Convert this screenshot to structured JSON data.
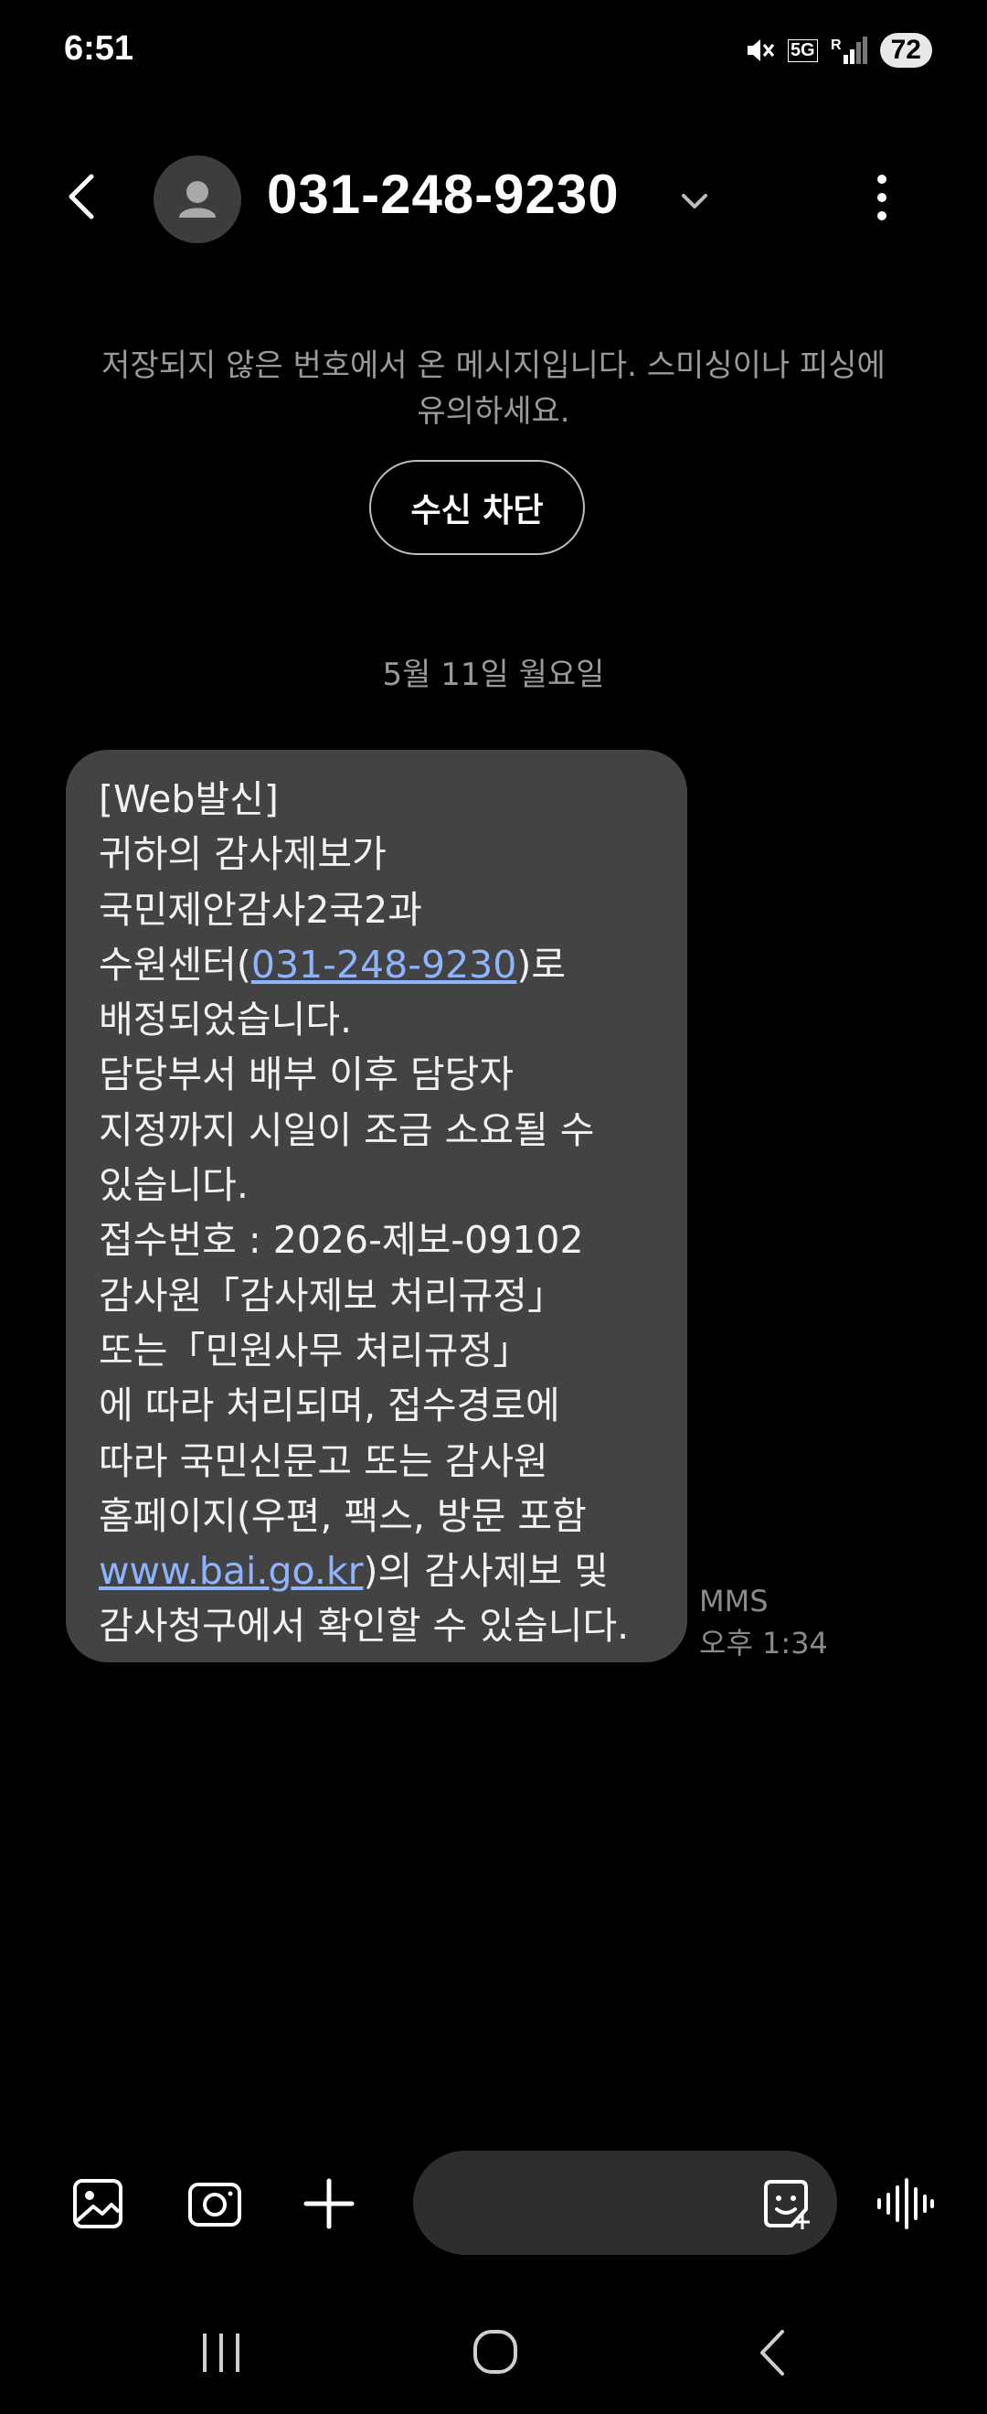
{
  "status_bar": {
    "time": "6:51",
    "network": "5G",
    "battery": "72"
  },
  "header": {
    "contact": "031-248-9230"
  },
  "warning": {
    "text": "저장되지 않은 번호에서 온 메시지입니다. 스미싱이나 피싱에 유의하세요.",
    "block_label": "수신 차단"
  },
  "date_separator": "5월 11일 월요일",
  "message": {
    "lines": [
      "[Web발신]",
      "귀하의 감사제보가",
      "국민제안감사2국2과",
      "수원센터(",
      "031-248-9230",
      ")로",
      "배정되었습니다.",
      "담당부서 배부 이후 담당자",
      "지정까지 시일이 조금 소요될 수",
      "있습니다.",
      "접수번호 : 2026-제보-09102",
      "감사원「감사제보 처리규정」",
      "또는「민원사무 처리규정」",
      "에 따라 처리되며, 접수경로에",
      "따라 국민신문고 또는 감사원",
      "홈페이지(우편, 팩스, 방문 포함",
      "www.bai.go.kr",
      ")의 감사제보 및",
      "감사청구에서 확인할 수 있습니다."
    ],
    "type": "MMS",
    "time": "오후 1:34"
  },
  "input_bar": {
    "icons": [
      "gallery-icon",
      "camera-icon",
      "add-icon",
      "sticker-icon",
      "voice-icon"
    ]
  },
  "nav_bar": {
    "icons": [
      "recents-icon",
      "home-icon",
      "back-icon"
    ]
  },
  "colors": {
    "background": "#000000",
    "bubble": "#434343",
    "link": "#8fb4ff",
    "secondary_text": "#9a9a9a"
  }
}
